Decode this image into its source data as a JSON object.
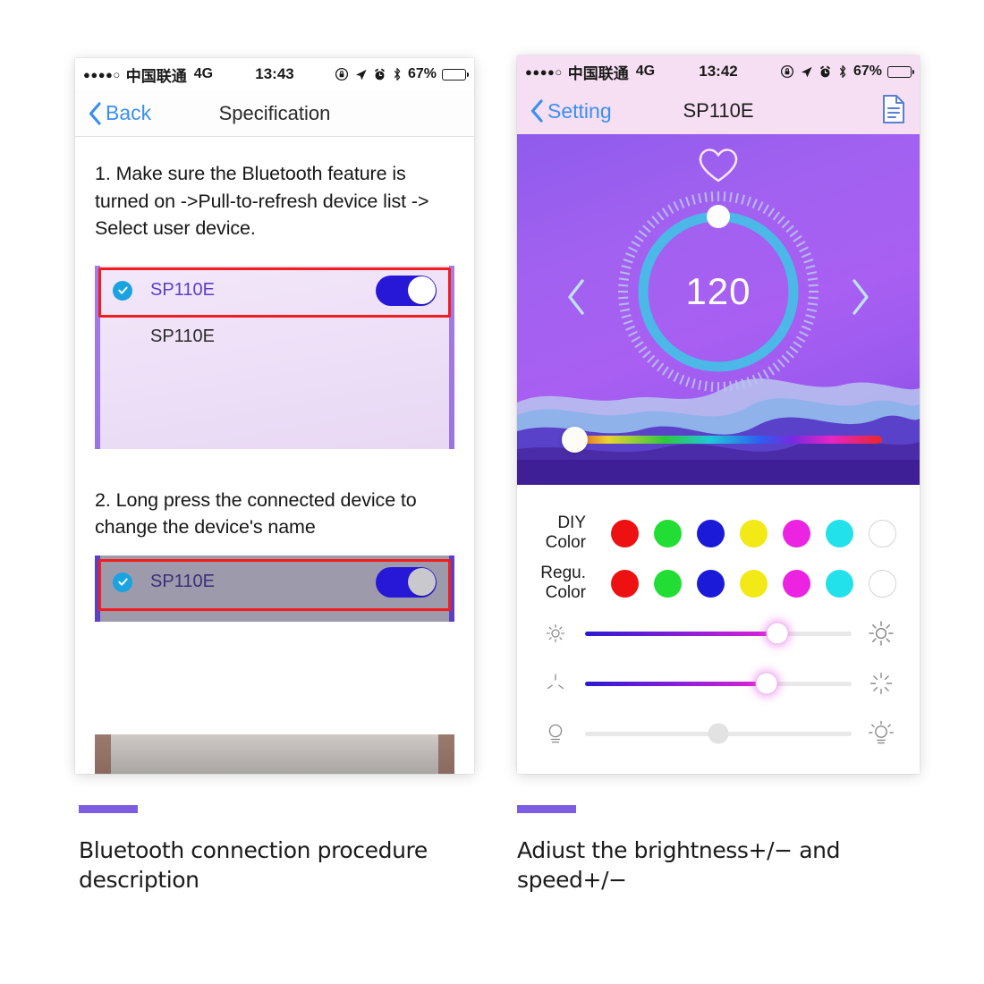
{
  "left_phone": {
    "status_bar": {
      "signal_dots": "●●●●○",
      "carrier": "中国联通",
      "network": "4G",
      "time": "13:43",
      "battery_pct": "67%",
      "battery_level": 67,
      "icons": [
        "rotation-lock-icon",
        "location-arrow-icon",
        "alarm-clock-icon",
        "bluetooth-icon",
        "battery-icon"
      ]
    },
    "nav": {
      "back_label": "Back",
      "title": "Specification"
    },
    "steps": [
      {
        "text": "1. Make sure the Bluetooth feature is turned on ->Pull-to-refresh device list -> Select user device."
      },
      {
        "text": "2. Long press the connected device to change the device's name"
      }
    ],
    "device_list_1": {
      "selected_device": "SP110E",
      "second_device": "SP110E",
      "toggle_on": true,
      "highlight_color": "#f31d1d"
    },
    "device_list_2": {
      "selected_device": "SP110E",
      "toggle_on": true,
      "highlight_color": "#f31d1d"
    }
  },
  "right_phone": {
    "status_bar": {
      "signal_dots": "●●●●○",
      "carrier": "中国联通",
      "network": "4G",
      "time": "13:42",
      "battery_pct": "67%",
      "battery_level": 67,
      "icons": [
        "rotation-lock-icon",
        "location-arrow-icon",
        "alarm-clock-icon",
        "bluetooth-icon",
        "battery-icon"
      ]
    },
    "nav": {
      "back_label": "Setting",
      "title": "SP110E",
      "right_icon": "document-icon"
    },
    "hero": {
      "favorite_icon": "heart-outline-icon",
      "dial_value": "120",
      "dial_progress_pct": 50,
      "prev_icon": "chevron-left-icon",
      "next_icon": "chevron-right-icon",
      "hue_slider_value_pct": 0
    },
    "controls": {
      "rows": [
        {
          "label": "DIY Color",
          "swatches": [
            "#ee1111",
            "#22dd33",
            "#1a1ad8",
            "#f2e916",
            "#ec23e0",
            "#22e1ea",
            "empty"
          ]
        },
        {
          "label": "Regu. Color",
          "swatches": [
            "#ee1111",
            "#22dd33",
            "#1a1ad8",
            "#f2e916",
            "#ec23e0",
            "#22e1ea",
            "empty"
          ]
        }
      ],
      "sliders": [
        {
          "left_icon": "sun-small-icon",
          "right_icon": "sun-large-icon",
          "value_pct": 72,
          "active": true
        },
        {
          "left_icon": "speed-slow-icon",
          "right_icon": "speed-fast-icon",
          "value_pct": 68,
          "active": true
        },
        {
          "left_icon": "bulb-dim-icon",
          "right_icon": "bulb-bright-icon",
          "value_pct": 50,
          "active": false
        }
      ]
    }
  },
  "captions": {
    "accent_color": "#7c5ce0",
    "left": "Bluetooth connection procedure description",
    "right": "Adiust the brightness+/− and speed+/−"
  }
}
